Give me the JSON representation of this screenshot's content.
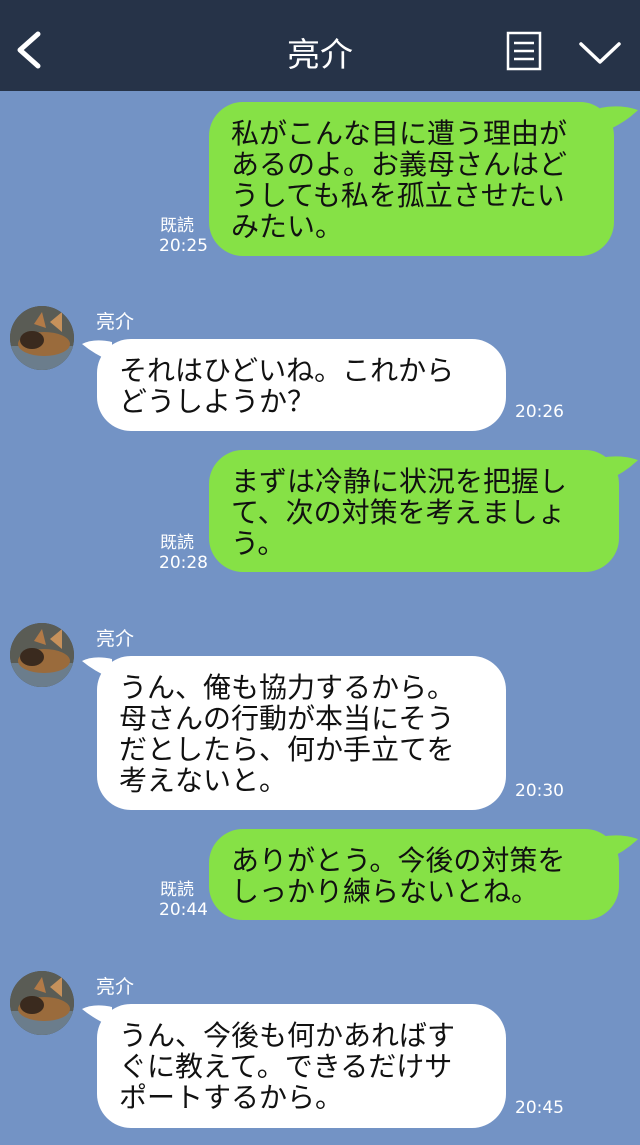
{
  "header": {
    "title": "亮介"
  },
  "messages": [
    {
      "side": "me",
      "lines": [
        "私がこんな目に遭う理由が",
        "あるのよ。お義母さんはど",
        "うしても私を孤立させたい",
        "みたい。"
      ],
      "read": "既読",
      "time": "20:25"
    },
    {
      "side": "you",
      "sender": "亮介",
      "lines": [
        "それはひどいね。これから",
        "どうしようか？"
      ],
      "time": "20:26"
    },
    {
      "side": "me",
      "lines": [
        "まずは冷静に状況を把握し",
        "て、次の対策を考えましょ",
        "う。"
      ],
      "read": "既読",
      "time": "20:28"
    },
    {
      "side": "you",
      "sender": "亮介",
      "lines": [
        "うん、俺も協力するから。",
        "母さんの行動が本当にそう",
        "だとしたら、何か手立てを",
        "考えないと。"
      ],
      "time": "20:30"
    },
    {
      "side": "me",
      "lines": [
        "ありがとう。今後の対策を",
        "しっかり練らないとね。"
      ],
      "read": "既読",
      "time": "20:44"
    },
    {
      "side": "you",
      "sender": "亮介",
      "lines": [
        "うん、今後も何かあればす",
        "ぐに教えて。できるだけサ",
        "ポートするから。"
      ],
      "time": "20:45"
    }
  ],
  "colors": {
    "header": "#263348",
    "background": "#7393c5",
    "me_bubble": "#86e146",
    "you_bubble": "#ffffff"
  },
  "icons": [
    "back-arrow-icon",
    "notes-icon",
    "chevron-down-icon"
  ]
}
